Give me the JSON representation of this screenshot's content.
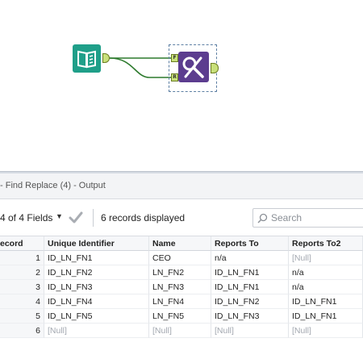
{
  "canvas": {
    "input_tool": {
      "icon": "book-input-icon"
    },
    "find_replace_tool": {
      "icon": "find-replace-icon",
      "anchor_f_label": "F",
      "anchor_r_label": "R"
    }
  },
  "results": {
    "title": "- Find Replace (4) - Output",
    "fields_label": "4 of 4 Fields",
    "records_label": "6 records displayed",
    "search_placeholder": "Search",
    "columns": [
      "ecord",
      "Unique Identifier",
      "Name",
      "Reports To",
      "Reports To2"
    ],
    "rows": [
      [
        "1",
        "ID_LN_FN1",
        "CEO",
        "n/a",
        "[Null]"
      ],
      [
        "2",
        "ID_LN_FN2",
        "LN_FN2",
        "ID_LN_FN1",
        "n/a"
      ],
      [
        "3",
        "ID_LN_FN3",
        "LN_FN3",
        "ID_LN_FN1",
        "n/a"
      ],
      [
        "4",
        "ID_LN_FN4",
        "LN_FN4",
        "ID_LN_FN2",
        "ID_LN_FN1"
      ],
      [
        "5",
        "ID_LN_FN5",
        "LN_FN5",
        "ID_LN_FN3",
        "ID_LN_FN1"
      ],
      [
        "6",
        "[Null]",
        "[Null]",
        "[Null]",
        "[Null]"
      ]
    ]
  },
  "colors": {
    "input_tool": "#1f9f89",
    "find_replace_tool": "#5c3d8f",
    "anchor": "#c8e07a",
    "connector": "#2d7a2d"
  }
}
